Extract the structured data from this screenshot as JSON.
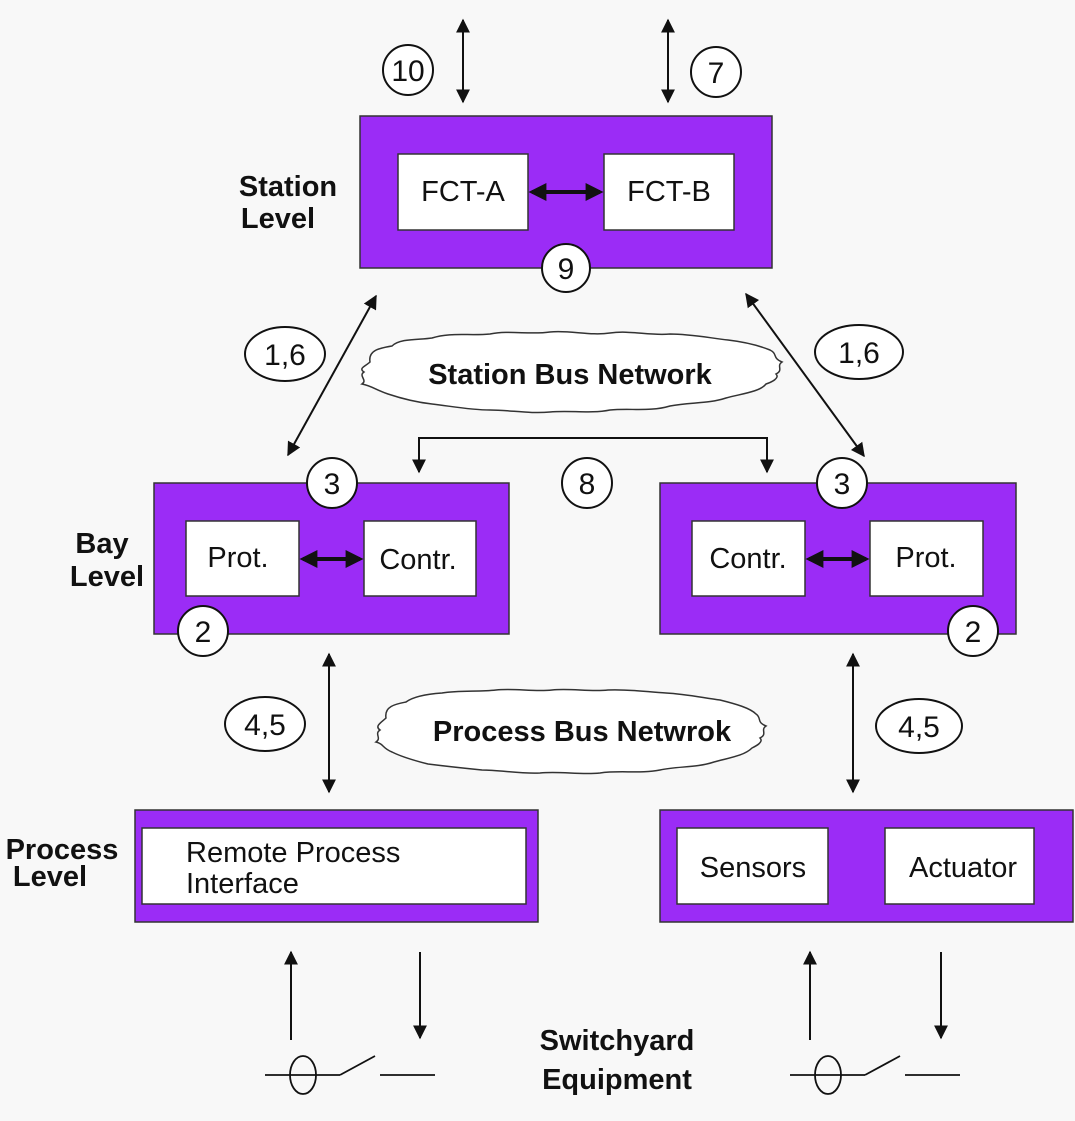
{
  "colors": {
    "level_box": "#9b2cf6",
    "inner_box": "#ffffff",
    "stroke": "#111111",
    "background": "#f8f8f8"
  },
  "levels": {
    "station": [
      "Station",
      "Level"
    ],
    "bay": [
      "Bay",
      "Level"
    ],
    "process": [
      "Process",
      "Level"
    ],
    "switchyard": [
      "Switchyard",
      "Equipment"
    ]
  },
  "station": {
    "fct_a": "FCT-A",
    "fct_b": "FCT-B"
  },
  "bay_left": {
    "prot": "Prot.",
    "contr": "Contr."
  },
  "bay_right": {
    "contr": "Contr.",
    "prot": "Prot."
  },
  "process_left": {
    "line1": "Remote Process",
    "line2": "Interface"
  },
  "process_right": {
    "sensors": "Sensors",
    "actuator": "Actuator"
  },
  "networks": {
    "station_bus": "Station Bus Network",
    "process_bus": "Process Bus Netwrok"
  },
  "markers": {
    "m10": "10",
    "m7": "7",
    "m9": "9",
    "m16_left": "1,6",
    "m16_right": "1,6",
    "m3_left": "3",
    "m3_right": "3",
    "m8": "8",
    "m2_left": "2",
    "m2_right": "2",
    "m45_left": "4,5",
    "m45_right": "4,5"
  }
}
